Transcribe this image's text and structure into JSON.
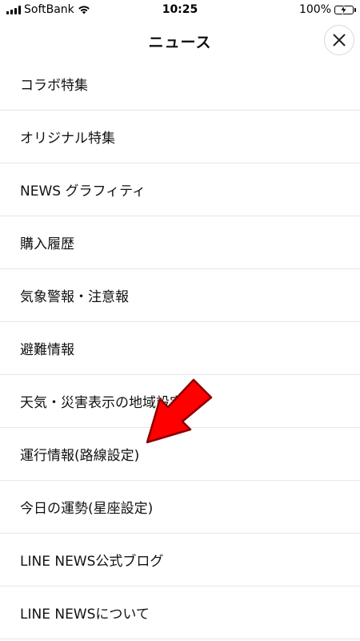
{
  "status_bar": {
    "carrier": "SoftBank",
    "time": "10:25",
    "battery_percent": "100%",
    "battery_color": "#4cd964"
  },
  "header": {
    "title": "ニュース",
    "close_icon": "close-icon"
  },
  "menu": {
    "items": [
      {
        "label": "コラボ特集"
      },
      {
        "label": "オリジナル特集"
      },
      {
        "label": "NEWS グラフィティ"
      },
      {
        "label": "購入履歴"
      },
      {
        "label": "気象警報・注意報"
      },
      {
        "label": "避難情報"
      },
      {
        "label": "天気・災害表示の地域設定"
      },
      {
        "label": "運行情報(路線設定)"
      },
      {
        "label": "今日の運勢(星座設定)"
      },
      {
        "label": "LINE NEWS公式ブログ"
      },
      {
        "label": "LINE NEWSについて"
      }
    ]
  },
  "annotation": {
    "arrow_color": "#ff0000",
    "arrow_icon": "red-arrow-icon"
  }
}
